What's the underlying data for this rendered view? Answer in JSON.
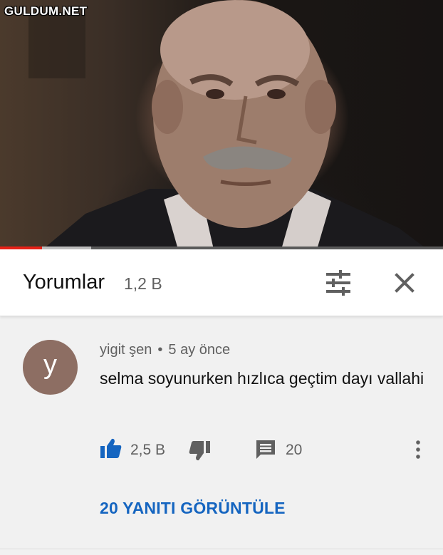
{
  "watermark": "GULDUM.NET",
  "video": {
    "progress_played": 0.095,
    "progress_buffered": 0.205
  },
  "header": {
    "title": "Yorumlar",
    "count": "1,2 B"
  },
  "comment": {
    "avatar_letter": "y",
    "avatar_color": "#8d6e63",
    "author": "yigit şen",
    "separator": "•",
    "time": "5 ay önce",
    "text": "selma soyunurken hızlıca geçtim dayı vallahi",
    "likes": "2,5 B",
    "replies": "20",
    "view_replies": "20 YANITI GÖRÜNTÜLE"
  },
  "icons": {
    "sort": "sort-filter-icon",
    "close": "close-icon",
    "like": "thumbs-up-icon",
    "dislike": "thumbs-down-icon",
    "reply": "comment-icon",
    "more": "more-vert-icon"
  },
  "colors": {
    "accent": "#1565c0",
    "progress": "#e62117",
    "avatar": "#8d6e63"
  }
}
